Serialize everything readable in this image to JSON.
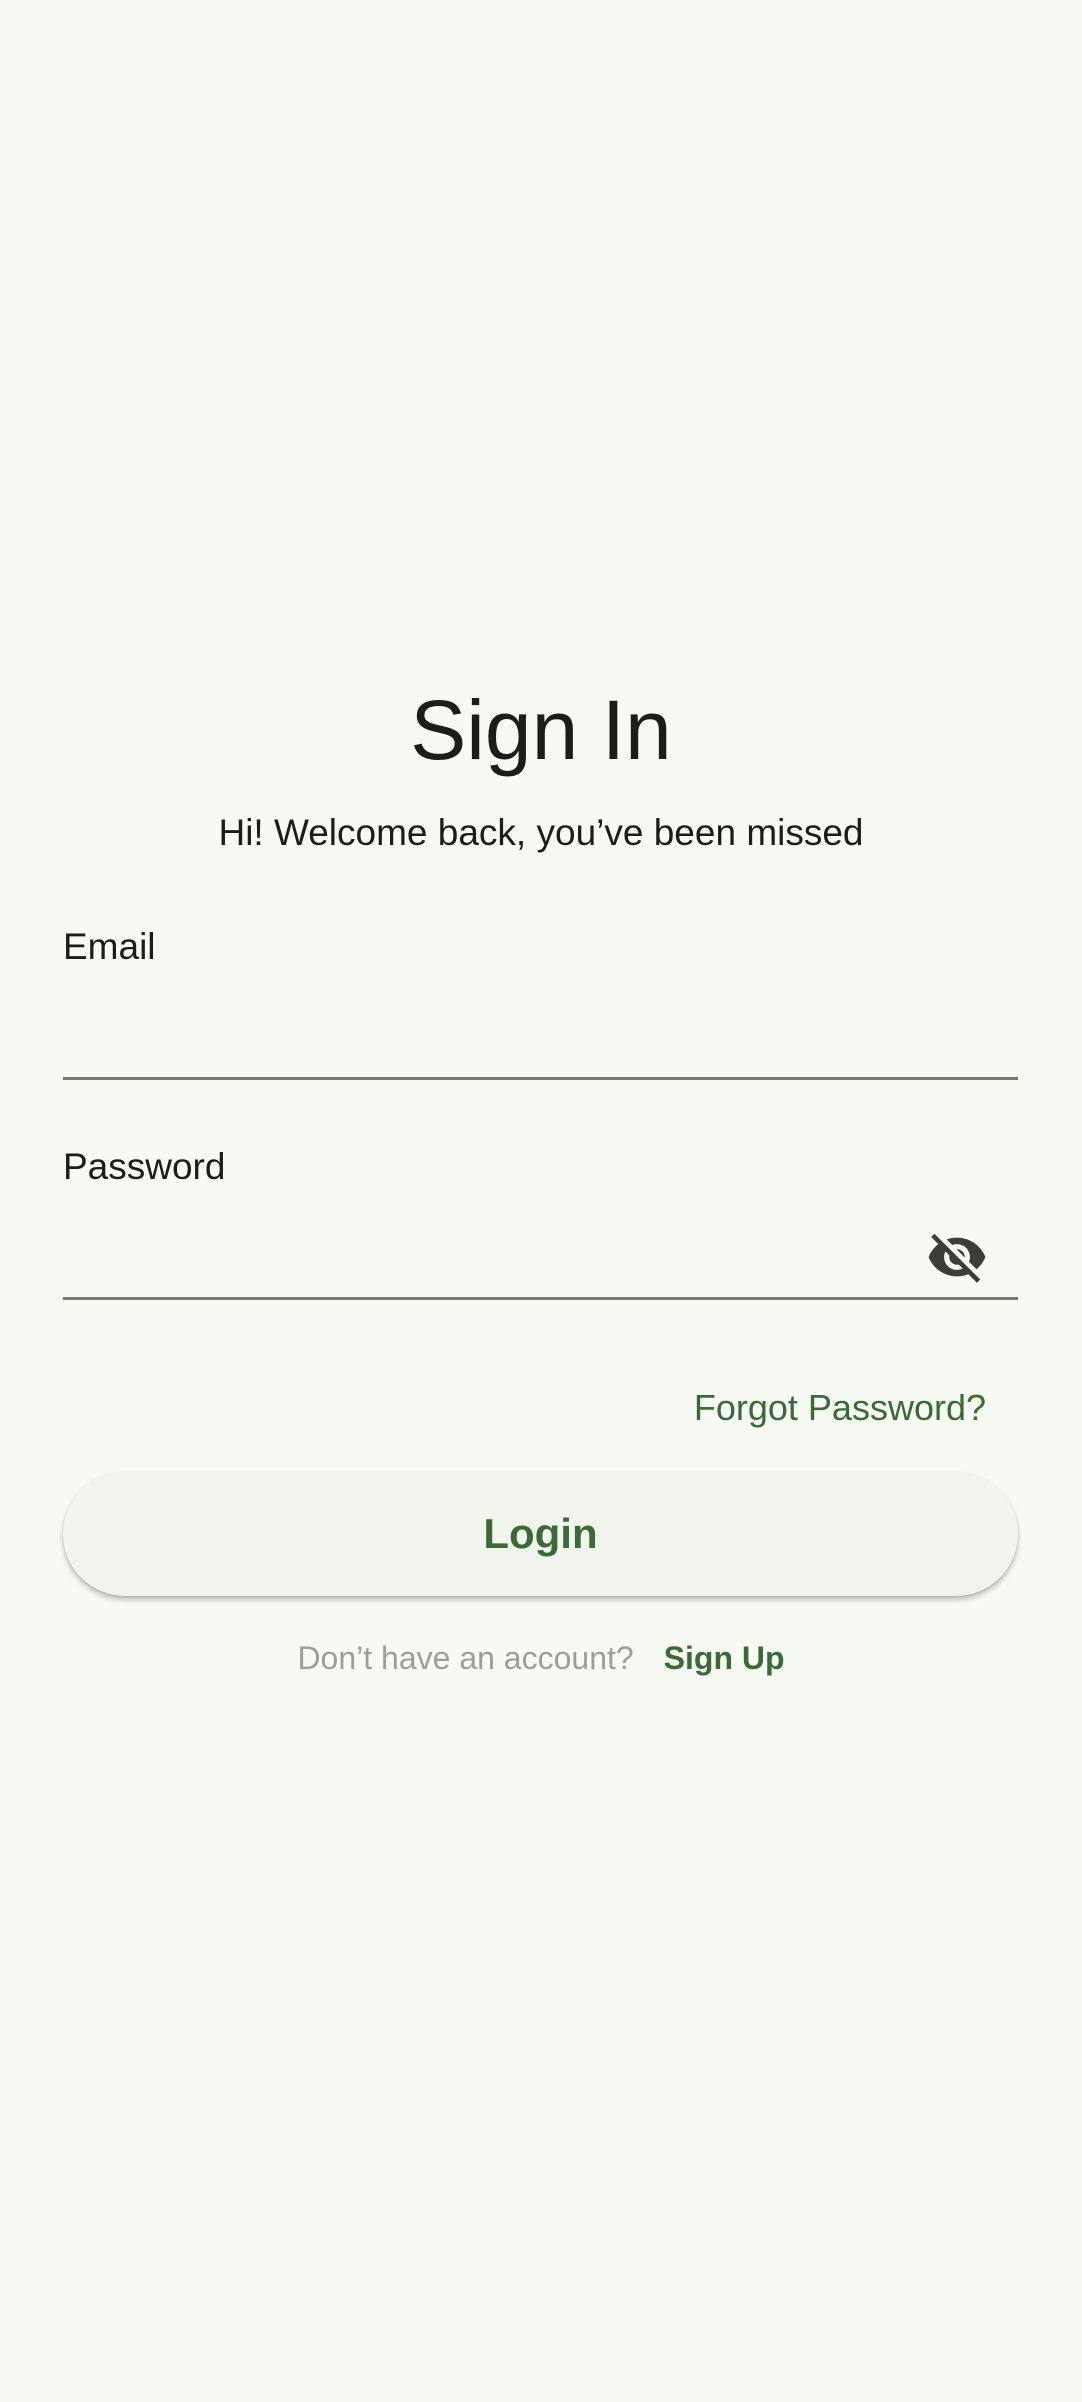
{
  "header": {
    "title": "Sign In",
    "subtitle": "Hi! Welcome back, you’ve been missed"
  },
  "form": {
    "email": {
      "label": "Email",
      "value": "",
      "placeholder": ""
    },
    "password": {
      "label": "Password",
      "value": "",
      "placeholder": "",
      "toggle_icon": "visibility-off-icon"
    },
    "forgot_label": "Forgot Password?",
    "login_label": "Login"
  },
  "footer": {
    "prompt": "Don’t have an account?",
    "signup_label": "Sign Up"
  },
  "colors": {
    "background": "#f7faf2",
    "accent": "#3b6a38",
    "text": "#1b1d19",
    "muted": "#9c9e98",
    "underline": "#74796e"
  }
}
